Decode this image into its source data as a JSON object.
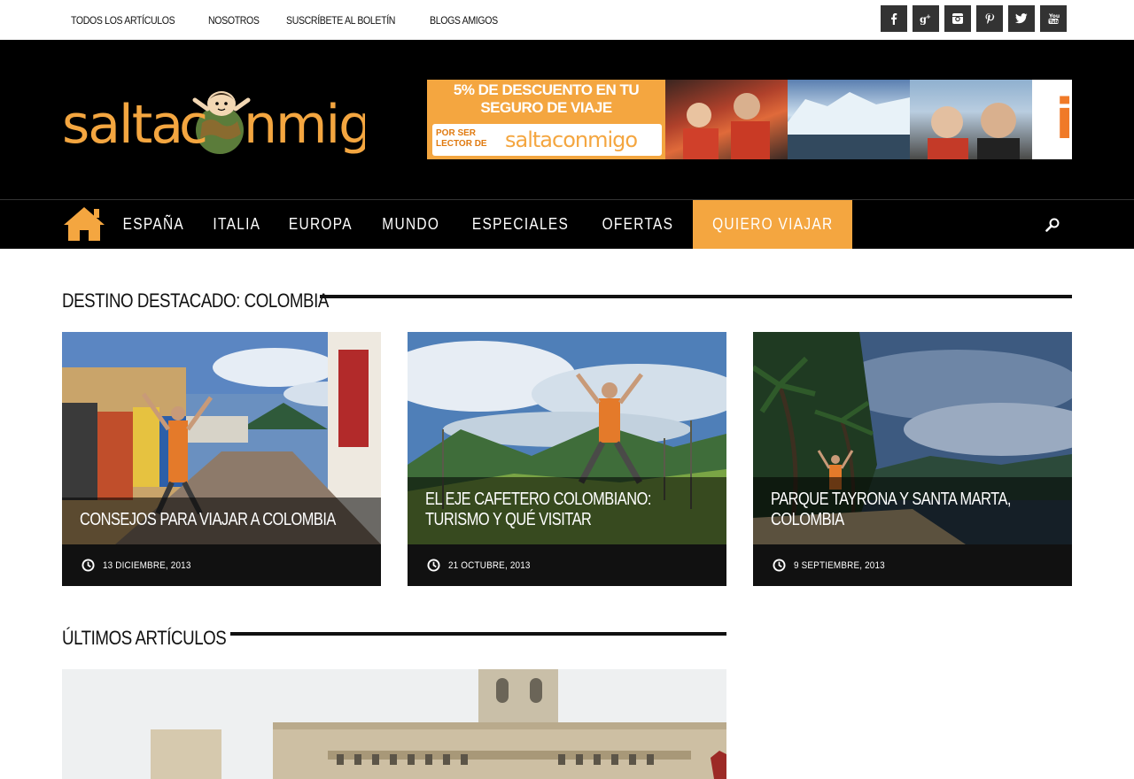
{
  "topnav": {
    "items": [
      "TODOS LOS ARTÍCULOS",
      "NOSOTROS",
      "SUSCRÍBETE AL BOLETÍN",
      "BLOGS AMIGOS"
    ]
  },
  "social": {
    "icons": [
      "facebook-icon",
      "google-plus-icon",
      "instagram-icon",
      "pinterest-icon",
      "twitter-icon",
      "youtube-icon"
    ]
  },
  "header": {
    "logo_text": "saltaconmigo",
    "banner": {
      "line1": "5% DE DESCUENTO EN TU",
      "line2": "SEGURO DE VIAJE",
      "line3": "POR SER LECTOR DE",
      "brand": "saltaconmigo",
      "partner": "iati"
    }
  },
  "mainnav": {
    "items": [
      {
        "label": "ESPAÑA",
        "active": false
      },
      {
        "label": "ITALIA",
        "active": false
      },
      {
        "label": "EUROPA",
        "active": false
      },
      {
        "label": "MUNDO",
        "active": false
      },
      {
        "label": "ESPECIALES",
        "active": false
      },
      {
        "label": "OFERTAS",
        "active": false
      },
      {
        "label": "QUIERO VIAJAR",
        "active": true
      }
    ]
  },
  "featured": {
    "title": "DESTINO DESTACADO: COLOMBIA",
    "cards": [
      {
        "title": "CONSEJOS PARA VIAJAR A COLOMBIA",
        "date": "13 DICIEMBRE, 2013"
      },
      {
        "title": "EL EJE CAFETERO COLOMBIANO: TURISMO Y QUÉ VISITAR",
        "date": "21 OCTUBRE, 2013"
      },
      {
        "title": "PARQUE TAYRONA Y SANTA MARTA, COLOMBIA",
        "date": "9 SEPTIEMBRE, 2013"
      }
    ]
  },
  "latest": {
    "title": "ÚLTIMOS ARTÍCULOS"
  },
  "colors": {
    "accent": "#f4a640",
    "nav_bg": "#000000",
    "social_bg": "#333333"
  }
}
